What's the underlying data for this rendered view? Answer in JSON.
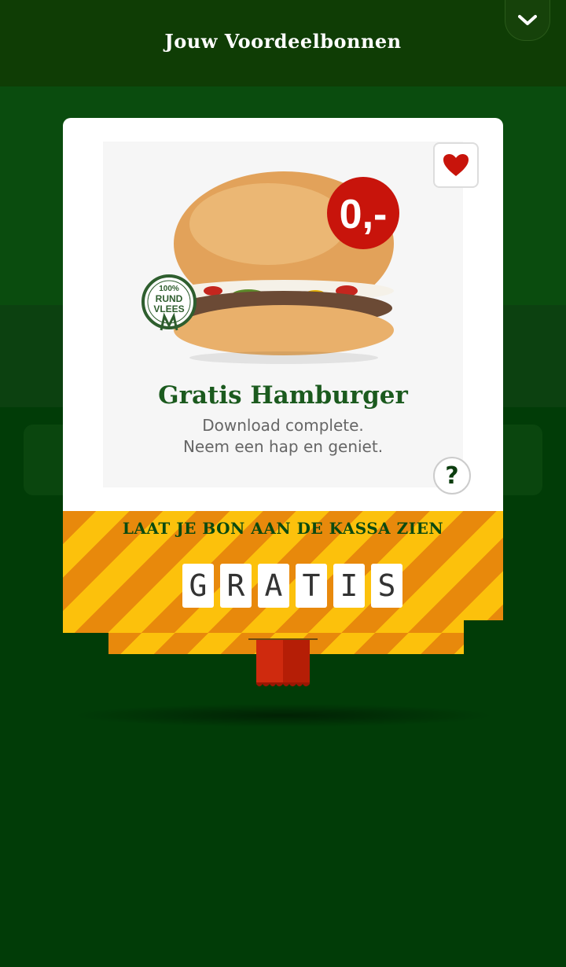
{
  "header": {
    "title": "Jouw Voordeelbonnen",
    "collapse_icon": "chevron-down-icon"
  },
  "coupon": {
    "price_badge": "0,-",
    "beef_badge": [
      "100%",
      "RUND",
      "VLEES"
    ],
    "headline": "Gratis Hamburger",
    "subline1": "Download complete.",
    "subline2": "Neem een hap en geniet.",
    "favorite_icon": "heart-icon",
    "help_label": "?"
  },
  "redeem": {
    "instruction": "LAAT JE BON AAN DE KASSA ZIEN",
    "code": [
      "G",
      "R",
      "A",
      "T",
      "I",
      "S"
    ]
  },
  "colors": {
    "header_bg": "#0f3d05",
    "page_bg": "#013c07",
    "stripe_orange": "#e8890c",
    "stripe_yellow": "#fcc10c",
    "heart_red": "#c8140b",
    "text_green": "#0a4a10"
  }
}
